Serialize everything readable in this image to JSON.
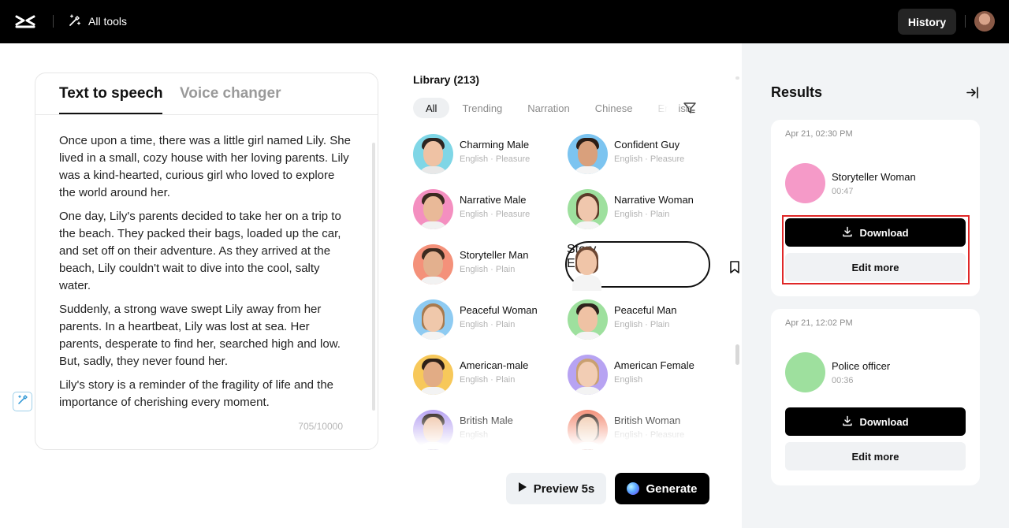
{
  "topbar": {
    "all_tools_label": "All tools",
    "history_label": "History"
  },
  "editor": {
    "tabs": [
      {
        "label": "Text to speech",
        "active": true
      },
      {
        "label": "Voice changer",
        "active": false
      }
    ],
    "paragraphs": [
      "Once upon a time, there was a little girl named Lily. She lived in a small, cozy house with her loving parents. Lily was a kind-hearted, curious girl who loved to explore the world around her.",
      "One day, Lily's parents decided to take her on a trip to the beach. They packed their bags, loaded up the car, and set off on their adventure. As they arrived at the beach, Lily couldn't wait to dive into the cool, salty water.",
      "Suddenly, a strong wave swept Lily away from her parents. In a heartbeat, Lily was lost at sea. Her parents, desperate to find her, searched high and low. But, sadly, they never found her.",
      "Lily's story is a reminder of the fragility of life and the importance of cherishing every moment."
    ],
    "counter": "705/10000"
  },
  "library": {
    "title": "Library (213)",
    "filters": [
      "All",
      "Trending",
      "Narration",
      "Chinese",
      "English"
    ],
    "active_filter": "All",
    "voices": [
      {
        "name": "Charming Male",
        "meta": "English · Pleasure",
        "bg": "#7fd6e6",
        "skin": "#efc2a4",
        "hair": "#2d2420",
        "shirt": "#e8e8e8",
        "long": false
      },
      {
        "name": "Confident Guy",
        "meta": "English · Pleasure",
        "bg": "#7cc4f0",
        "skin": "#d9a07c",
        "hair": "#2b1d16",
        "shirt": "#f4f4f4",
        "long": false
      },
      {
        "name": "Narrative Male",
        "meta": "English · Pleasure",
        "bg": "#f48fc0",
        "skin": "#e9b998",
        "hair": "#3a2a20",
        "shirt": "#f1f1f1",
        "long": false
      },
      {
        "name": "Narrative Woman",
        "meta": "English · Plain",
        "bg": "#9ee09e",
        "skin": "#f0c7ad",
        "hair": "#5a3a28",
        "shirt": "#f4f4f4",
        "long": true
      },
      {
        "name": "Storyteller Man",
        "meta": "English · Plain",
        "bg": "#f4917a",
        "skin": "#e3b08e",
        "hair": "#3b2a1f",
        "shirt": "#f2f2f2",
        "long": false
      },
      {
        "name": "Storyteller Woman",
        "meta": "English · Plain",
        "bg": "#f59ac8",
        "skin": "#f0c5a8",
        "hair": "#6b4632",
        "shirt": "#f4f4f4",
        "long": true
      },
      {
        "name": "Peaceful Woman",
        "meta": "English · Plain",
        "bg": "#8ecbf2",
        "skin": "#f0c8ab",
        "hair": "#a87a4e",
        "shirt": "#f3f3f3",
        "long": true
      },
      {
        "name": "Peaceful Man",
        "meta": "English · Plain",
        "bg": "#9ee09e",
        "skin": "#efc2a4",
        "hair": "#2e221c",
        "shirt": "#f4f4f4",
        "long": false
      },
      {
        "name": "American-male",
        "meta": "English · Plain",
        "bg": "#f7c85a",
        "skin": "#e2ac85",
        "hair": "#2d2018",
        "shirt": "#f3f3f3",
        "long": false
      },
      {
        "name": "American Female",
        "meta": "English",
        "bg": "#b7a3f2",
        "skin": "#f2cdb4",
        "hair": "#c9a070",
        "shirt": "#f3f3f3",
        "long": true
      },
      {
        "name": "British Male",
        "meta": "English",
        "bg": "#b7a3f2",
        "skin": "#efc2a4",
        "hair": "#2b201a",
        "shirt": "#f3f3f3",
        "long": false
      },
      {
        "name": "British Woman",
        "meta": "English · Pleasure",
        "bg": "#f4917a",
        "skin": "#f0c8ab",
        "hair": "#3a2a22",
        "shirt": "#f3f3f3",
        "long": true
      }
    ],
    "hovered_voice": {
      "name": "Story",
      "meta": "Engli"
    }
  },
  "actions": {
    "preview_label": "Preview 5s",
    "generate_label": "Generate"
  },
  "results": {
    "title": "Results",
    "items": [
      {
        "date": "Apr 21, 02:30 PM",
        "name": "Storyteller Woman",
        "duration": "00:47",
        "download_label": "Download",
        "edit_label": "Edit more",
        "bg": "#f59ac8",
        "skin": "#f0c5a8",
        "hair": "#6b4632"
      },
      {
        "date": "Apr 21, 12:02 PM",
        "name": "Police officer",
        "duration": "00:36",
        "download_label": "Download",
        "edit_label": "Edit more",
        "bg": "#9ee09e",
        "skin": "#d9a07c",
        "hair": "#1f1814"
      }
    ]
  },
  "colors": {
    "accent": "#000000",
    "highlight": "#e02727"
  }
}
